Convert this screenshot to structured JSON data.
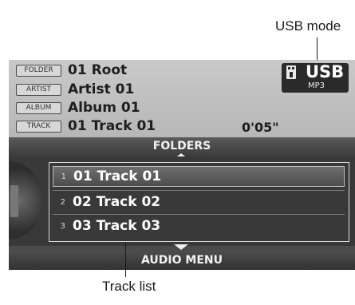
{
  "callouts": {
    "usb_mode": "USB mode",
    "track_list": "Track list"
  },
  "info": {
    "folder": {
      "tag": "FOLDER",
      "value": "01 Root"
    },
    "artist": {
      "tag": "ARTIST",
      "value": "Artist 01"
    },
    "album": {
      "tag": "ALBUM",
      "value": "Album 01"
    },
    "track": {
      "tag": "TRACK",
      "value": "01 Track 01",
      "time": "0'05\""
    }
  },
  "source": {
    "label": "USB",
    "format": "MP3",
    "icon": "usb-drive-icon"
  },
  "nav": {
    "folders_label": "FOLDERS",
    "audio_menu_label": "AUDIO MENU"
  },
  "tracks": [
    {
      "num": "1",
      "name": "01 Track 01",
      "selected": true
    },
    {
      "num": "2",
      "name": "02 Track 02",
      "selected": false
    },
    {
      "num": "3",
      "name": "03 Track 03",
      "selected": false
    }
  ]
}
